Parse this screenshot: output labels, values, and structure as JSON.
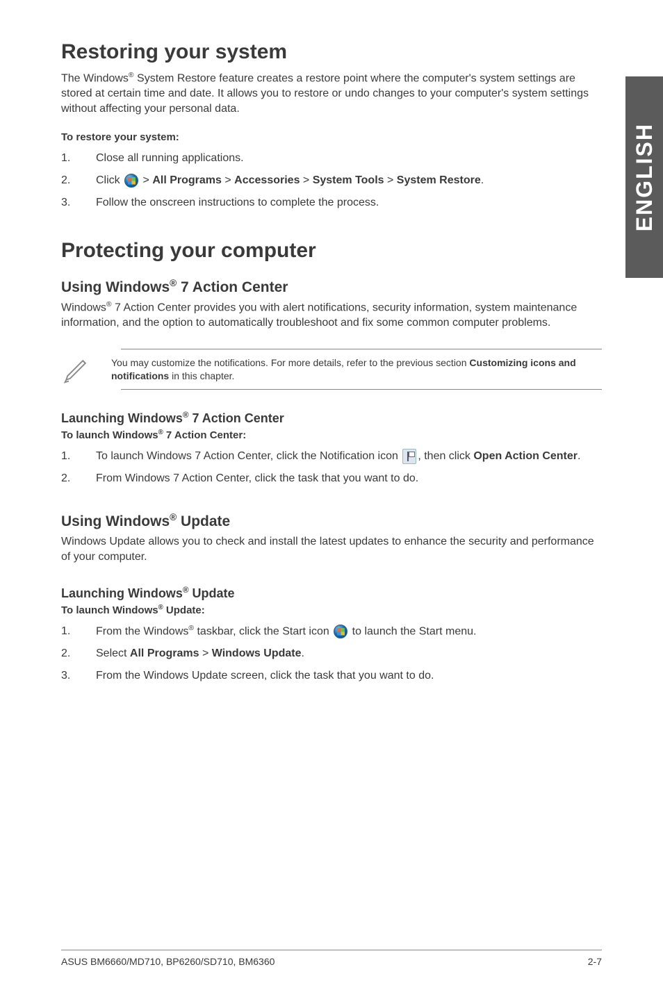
{
  "sideTab": "ENGLISH",
  "sections": {
    "restoring": {
      "title": "Restoring your system",
      "intro": "The Windows® System Restore feature creates a restore point where the computer's system settings are stored at certain time and date. It allows you to restore or undo changes to your computer's system settings without affecting your personal data.",
      "stepsTitle": "To restore your system:",
      "steps": {
        "s1": "Close all running applications.",
        "s2_pre": "Click ",
        "s2_post": " > All Programs > Accessories > System Tools > System Restore.",
        "s2_b1": "All Programs",
        "s2_b2": "Accessories",
        "s2_b3": "System Tools",
        "s2_b4": "System Restore",
        "s3": "Follow the onscreen instructions to complete the process."
      }
    },
    "protecting": {
      "title": "Protecting your computer",
      "actionCenter": {
        "heading": "Using Windows® 7 Action Center",
        "intro": "Windows® 7 Action Center provides you with alert notifications, security information, system maintenance information, and the option to automatically troubleshoot and fix some common computer problems.",
        "note_pre": "You may customize the notifications. For more details, refer to the previous section ",
        "note_bold": "Customizing icons and notifications",
        "note_post": " in this chapter.",
        "launchHeading": "Launching Windows® 7 Action Center",
        "launchSub": "To launch Windows® 7 Action Center:",
        "steps": {
          "s1_pre": "To launch Windows 7 Action Center, click the Notification icon ",
          "s1_mid": ", then click ",
          "s1_bold": "Open Action Center",
          "s1_post": ".",
          "s2": "From Windows 7 Action Center, click the task that you want to do."
        }
      },
      "update": {
        "heading": "Using Windows® Update",
        "intro": "Windows Update allows you to check and install the latest updates to enhance the security and performance of your computer.",
        "launchHeading": "Launching Windows® Update",
        "launchSub": "To launch Windows® Update:",
        "steps": {
          "s1_pre": "From the Windows® taskbar, click the Start icon ",
          "s1_post": " to launch the Start menu.",
          "s2_pre": "Select ",
          "s2_b1": "All Programs",
          "s2_mid": " > ",
          "s2_b2": "Windows Update",
          "s2_post": ".",
          "s3": "From the Windows Update screen, click the task that you want to do."
        }
      }
    }
  },
  "footer": {
    "left": "ASUS BM6660/MD710, BP6260/SD710, BM6360",
    "right": "2-7"
  }
}
